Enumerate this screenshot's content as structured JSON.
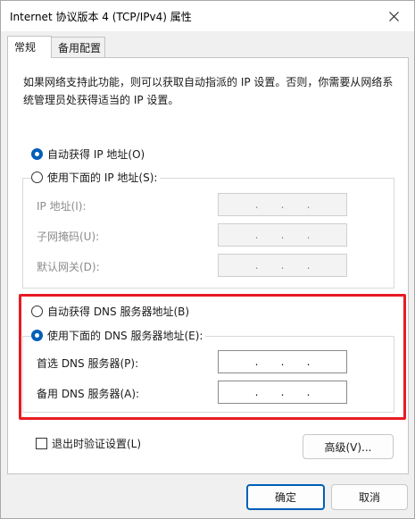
{
  "window": {
    "title": "Internet 协议版本 4 (TCP/IPv4) 属性"
  },
  "tabs": [
    {
      "label": "常规",
      "active": true
    },
    {
      "label": "备用配置",
      "active": false
    }
  ],
  "general": {
    "description": "如果网络支持此功能，则可以获取自动指派的 IP 设置。否则，你需要从网络系统管理员处获得适当的 IP 设置。",
    "ip_auto_label": "自动获得 IP 地址(O)",
    "ip_manual_label": "使用下面的 IP 地址(S):",
    "ip_fields": [
      {
        "label": "IP 地址(I):"
      },
      {
        "label": "子网掩码(U):"
      },
      {
        "label": "默认网关(D):"
      }
    ],
    "dns_auto_label": "自动获得 DNS 服务器地址(B)",
    "dns_manual_label": "使用下面的 DNS 服务器地址(E):",
    "dns_fields": [
      {
        "label": "首选 DNS 服务器(P):"
      },
      {
        "label": "备用 DNS 服务器(A):"
      }
    ],
    "ip_dot": ".",
    "validate_label": "退出时验证设置(L)",
    "advanced_label": "高级(V)..."
  },
  "footer": {
    "ok_label": "确定",
    "cancel_label": "取消"
  },
  "colors": {
    "accent": "#005fb8",
    "highlight_border": "#e81b23"
  },
  "state": {
    "ip_mode": "auto",
    "dns_mode": "manual",
    "validate_on_exit": false
  }
}
